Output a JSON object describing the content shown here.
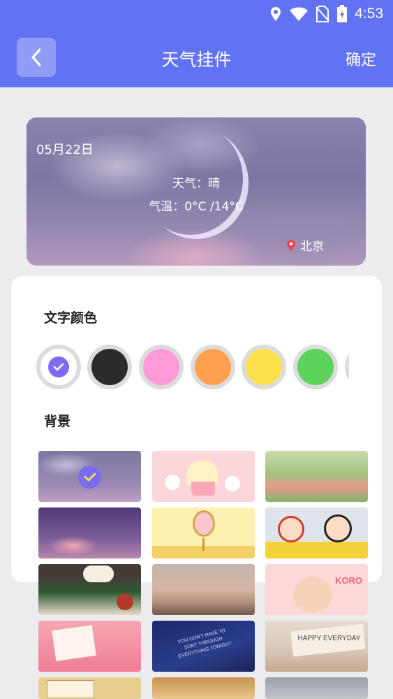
{
  "status_bar": {
    "time": "4:53",
    "icons": [
      "location-icon",
      "wifi-icon",
      "no-sim-icon",
      "battery-charging-icon"
    ]
  },
  "header": {
    "title": "天气挂件",
    "confirm_label": "确定",
    "back_icon": "chevron-left-icon"
  },
  "preview": {
    "date": "05月22日",
    "weather": "天气：晴",
    "temperature": "气温：0°C /14°C",
    "location": "北京"
  },
  "text_color": {
    "title": "文字颜色",
    "options": [
      {
        "name": "white",
        "color": "#ffffff",
        "selected": true
      },
      {
        "name": "black",
        "color": "#2b2b2b",
        "selected": false
      },
      {
        "name": "pink",
        "color": "#fe9ad8",
        "selected": false
      },
      {
        "name": "orange",
        "color": "#fea04e",
        "selected": false
      },
      {
        "name": "yellow",
        "color": "#fde14c",
        "selected": false
      },
      {
        "name": "green",
        "color": "#5cd45c",
        "selected": false
      },
      {
        "name": "lavender",
        "color": "#b6b0f2",
        "selected": false
      }
    ]
  },
  "background": {
    "title": "背景",
    "options": [
      {
        "name": "purple-cloud-moon",
        "selected": true
      },
      {
        "name": "cupcake-animals",
        "selected": false
      },
      {
        "name": "flower-garden-cartoon",
        "selected": false
      },
      {
        "name": "pink-cloud-stars",
        "selected": false
      },
      {
        "name": "yellow-mirror",
        "selected": false
      },
      {
        "name": "crayon-kids",
        "selected": false
      },
      {
        "name": "dog-on-sofa",
        "selected": false
      },
      {
        "name": "reeds-sunset",
        "selected": false
      },
      {
        "name": "koro-girl",
        "selected": false
      },
      {
        "name": "pink-flower-note",
        "selected": false
      },
      {
        "name": "blue-text-quote",
        "selected": false
      },
      {
        "name": "happy-everyday-card",
        "selected": false
      },
      {
        "name": "notebook-sketch",
        "selected": false
      },
      {
        "name": "cozy-room",
        "selected": false
      },
      {
        "name": "gray-moon",
        "selected": false
      }
    ],
    "captions": {
      "card": "HAPPY EVERYDAY",
      "koro": "KORO",
      "quote": "YOU DON'T HAVE TO SORT THROUGH EVERYTHING TONIGHT"
    }
  },
  "accent_color": "#6172f3",
  "check_color": "#7b6cf2"
}
